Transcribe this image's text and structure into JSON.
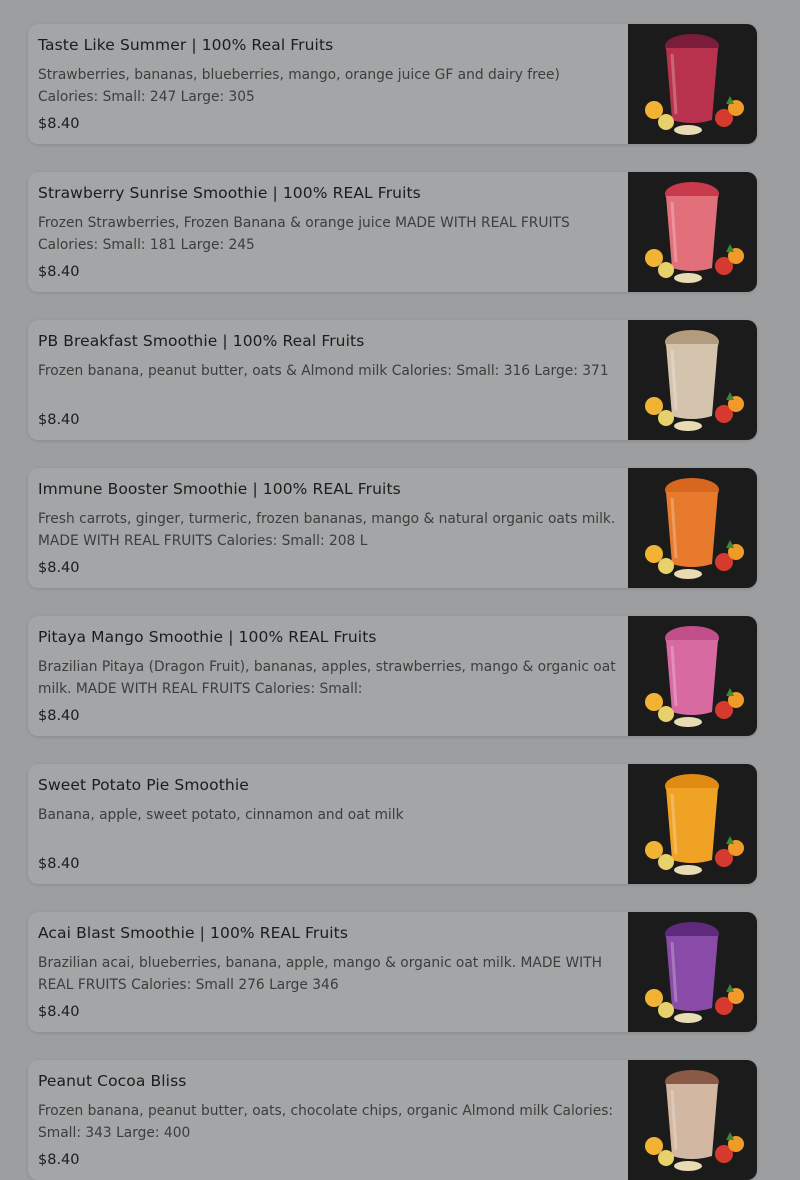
{
  "menu": {
    "items": [
      {
        "title": "Taste Like Summer | 100% Real Fruits",
        "description": "Strawberries, bananas, blueberries, mango, orange juice GF and dairy free) Calories: Small: 247 Large: 305",
        "price": "$8.40",
        "image_icon": "smoothie-cup-icon",
        "cup_color": "#b8324e",
        "cup_top_color": "#7a1d3a"
      },
      {
        "title": "Strawberry Sunrise Smoothie | 100% REAL Fruits",
        "description": "Frozen Strawberries, Frozen Banana & orange juice MADE WITH REAL FRUITS Calories: Small: 181 Large: 245",
        "price": "$8.40",
        "image_icon": "smoothie-cup-icon",
        "cup_color": "#e2707b",
        "cup_top_color": "#c83a4c"
      },
      {
        "title": "PB Breakfast Smoothie | 100% Real Fruits",
        "description": "Frozen banana, peanut butter, oats & Almond milk Calories: Small: 316 Large: 371",
        "price": "$8.40",
        "image_icon": "smoothie-cup-icon",
        "cup_color": "#d4c3ad",
        "cup_top_color": "#b49b7d"
      },
      {
        "title": "Immune Booster Smoothie | 100% REAL Fruits",
        "description": "Fresh carrots, ginger, turmeric, frozen bananas, mango & natural organic oats milk. MADE WITH REAL FRUITS Calories: Small: 208 L",
        "price": "$8.40",
        "image_icon": "smoothie-cup-icon",
        "cup_color": "#e87a2e",
        "cup_top_color": "#d7661f"
      },
      {
        "title": "Pitaya Mango Smoothie | 100% REAL Fruits",
        "description": "Brazilian Pitaya (Dragon Fruit), bananas, apples, strawberries, mango & organic oat milk. MADE WITH REAL FRUITS Calories: Small:",
        "price": "$8.40",
        "image_icon": "smoothie-cup-icon",
        "cup_color": "#d76aa0",
        "cup_top_color": "#c24f8c"
      },
      {
        "title": "Sweet Potato Pie Smoothie",
        "description": "Banana, apple, sweet potato, cinnamon and oat milk",
        "price": "$8.40",
        "image_icon": "smoothie-cup-icon",
        "cup_color": "#f0a224",
        "cup_top_color": "#e08c14"
      },
      {
        "title": "Acai Blast Smoothie | 100% REAL Fruits",
        "description": "Brazilian acai, blueberries, banana, apple, mango & organic oat milk. MADE WITH REAL FRUITS Calories: Small 276 Large 346",
        "price": "$8.40",
        "image_icon": "smoothie-cup-icon",
        "cup_color": "#8a4aa8",
        "cup_top_color": "#5e2a7c"
      },
      {
        "title": "Peanut Cocoa Bliss",
        "description": "Frozen banana, peanut butter, oats, chocolate chips, organic Almond milk Calories: Small: 343 Large: 400",
        "price": "$8.40",
        "image_icon": "smoothie-cup-icon",
        "cup_color": "#d2b7a2",
        "cup_top_color": "#8a5a46"
      }
    ]
  }
}
